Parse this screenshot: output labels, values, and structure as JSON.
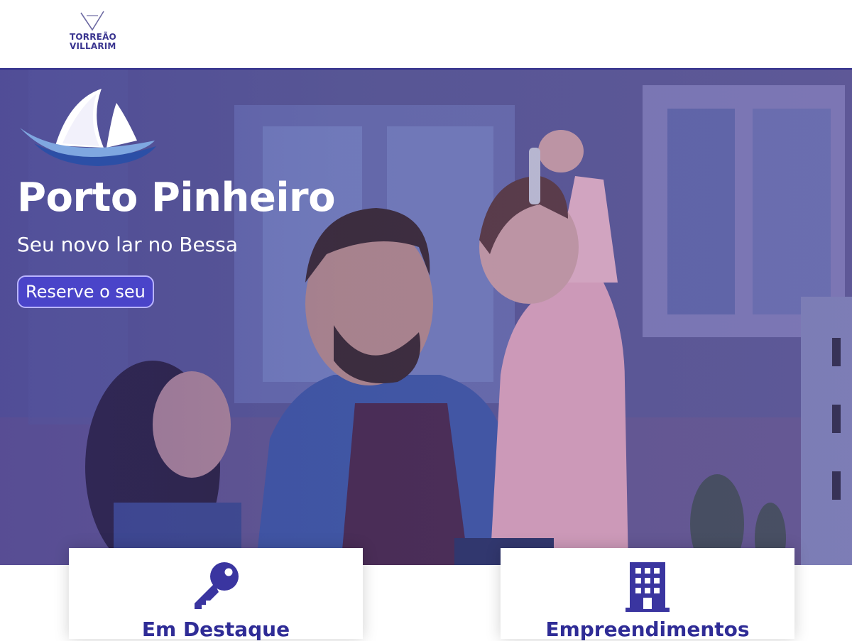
{
  "brand": {
    "line1": "TORREÃO",
    "line2": "VILLARIM"
  },
  "hero": {
    "title": "Porto Pinheiro",
    "subtitle": "Seu novo lar no Bessa",
    "cta_label": "Reserve o seu"
  },
  "cards": [
    {
      "label": "Em Destaque",
      "icon": "key-icon"
    },
    {
      "label": "Empreendimentos",
      "icon": "building-icon"
    }
  ],
  "colors": {
    "accent": "#3a35a0",
    "cta_background": "#4a44c9",
    "card_text": "#2f2c96",
    "header_border": "#2e2c8a"
  }
}
